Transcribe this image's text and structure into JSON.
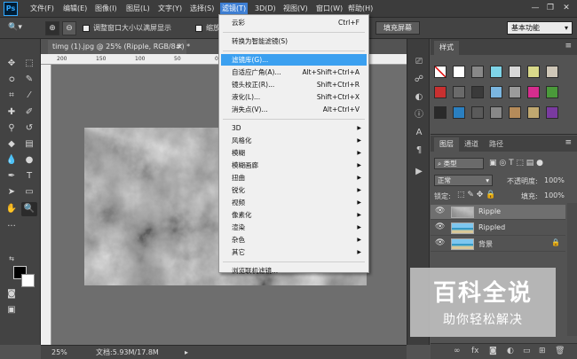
{
  "app": {
    "logo": "Ps"
  },
  "menubar": {
    "items": [
      "文件(F)",
      "编辑(E)",
      "图像(I)",
      "图层(L)",
      "文字(Y)",
      "选择(S)",
      "滤镜(T)",
      "3D(D)",
      "视图(V)",
      "窗口(W)",
      "帮助(H)"
    ],
    "active_index": 6
  },
  "window_controls": {
    "minimize": "—",
    "restore": "❐",
    "close": "✕"
  },
  "options_bar": {
    "resize_windows_label": "调整窗口大小以满屏显示",
    "zoom_all_label": "缩放所有",
    "fill_screen_label": "填充屏幕",
    "workspace": "基本功能"
  },
  "document": {
    "tab_title": "timg (1).jpg @ 25% (Ripple, RGB/8#) *",
    "tab_close": "×",
    "ruler_ticks": [
      "200",
      "150",
      "100",
      "50",
      "0"
    ]
  },
  "status_bar": {
    "zoom": "25%",
    "doc_size": "文档:5.93M/17.8M"
  },
  "filter_menu": {
    "items": [
      {
        "label": "云彩",
        "shortcut": "Ctrl+F"
      },
      {
        "separator": true
      },
      {
        "label": "转换为智能滤镜(S)"
      },
      {
        "separator": true
      },
      {
        "label": "滤镜库(G)...",
        "highlight": true
      },
      {
        "label": "自适应广角(A)...",
        "shortcut": "Alt+Shift+Ctrl+A"
      },
      {
        "label": "镜头校正(R)...",
        "shortcut": "Shift+Ctrl+R"
      },
      {
        "label": "液化(L)...",
        "shortcut": "Shift+Ctrl+X"
      },
      {
        "label": "消失点(V)...",
        "shortcut": "Alt+Ctrl+V"
      },
      {
        "separator": true
      },
      {
        "label": "3D",
        "submenu": true
      },
      {
        "label": "风格化",
        "submenu": true
      },
      {
        "label": "模糊",
        "submenu": true
      },
      {
        "label": "模糊画廊",
        "submenu": true
      },
      {
        "label": "扭曲",
        "submenu": true
      },
      {
        "label": "锐化",
        "submenu": true
      },
      {
        "label": "视频",
        "submenu": true
      },
      {
        "label": "像素化",
        "submenu": true
      },
      {
        "label": "渲染",
        "submenu": true
      },
      {
        "label": "杂色",
        "submenu": true
      },
      {
        "label": "其它",
        "submenu": true
      },
      {
        "separator": true
      },
      {
        "label": "浏览联机滤镜..."
      }
    ]
  },
  "styles_panel": {
    "tab": "样式",
    "swatch_colors": [
      "#ffffff",
      "#888888",
      "#7fd4e8",
      "#d8d8d8",
      "#d9d98a",
      "#cfc7b8",
      "#c83030",
      "#6a6a6a",
      "#3a3a3a",
      "#7bb6e0",
      "#9b9b9b",
      "#d62d8e",
      "#4a9a3a",
      "#2a2a2a",
      "#2a7fc0",
      "#5a5a5a",
      "#888888",
      "#b58b5a",
      "#c0a870",
      "#7a3aa0"
    ]
  },
  "layers_panel": {
    "tabs": [
      "图层",
      "通道",
      "路径"
    ],
    "filter_kind": "类型",
    "blend_mode": "正常",
    "opacity_label": "不透明度:",
    "opacity_value": "100%",
    "lock_label": "锁定:",
    "fill_label": "填充:",
    "fill_value": "100%",
    "layers": [
      {
        "name": "Ripple",
        "selected": true,
        "thumb": "clouds"
      },
      {
        "name": "Rippled",
        "selected": false,
        "thumb": "beach"
      },
      {
        "name": "背景",
        "selected": false,
        "thumb": "beach",
        "locked": true
      }
    ],
    "footer_icons": [
      "link-icon",
      "fx-icon",
      "mask-icon",
      "adjustment-icon",
      "folder-icon",
      "new-layer-icon",
      "trash-icon"
    ]
  },
  "watermark": {
    "title": "百科全说",
    "subtitle": "助你轻松解决"
  }
}
